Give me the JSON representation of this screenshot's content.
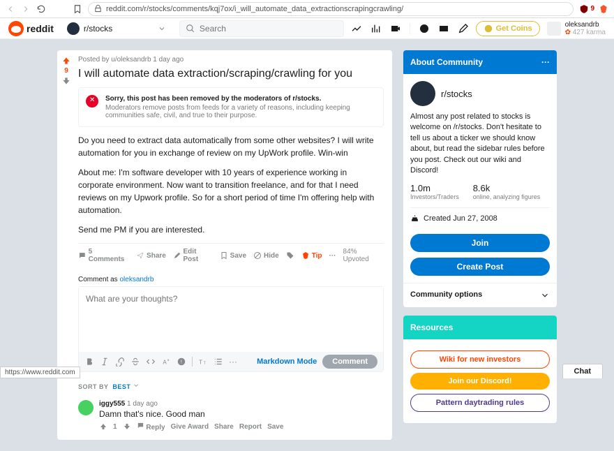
{
  "browser": {
    "url": "reddit.com/r/stocks/comments/kqj7ox/i_will_automate_data_extractionscrapingcrawling/",
    "status_url": "https://www.reddit.com",
    "ublock": "9"
  },
  "topbar": {
    "brand": "reddit",
    "sub": "r/stocks",
    "search_placeholder": "Search",
    "coins": "Get Coins",
    "username": "oleksandrb",
    "karma": "427 karma"
  },
  "post": {
    "score": "9",
    "meta": "Posted by u/oleksandrb 1 day ago",
    "title": "I will automate data extraction/scraping/crawling for you",
    "removed_bold": "Sorry, this post has been removed by the moderators of r/stocks.",
    "removed_text": "Moderators remove posts from feeds for a variety of reasons, including keeping communities safe, civil, and true to their purpose.",
    "p1": "Do you need to extract data automatically from some other websites? I will write automation for you in exchange of review on my UpWork profile. Win-win",
    "p2": "About me: I'm software developer with 10 years of experience working in corporate environment. Now want to transition freelance, and for that I need reviews on my Upwork profile. So for a short period of time I'm offering help with automation.",
    "p3": "Send me PM if you are interested.",
    "comments": "5 Comments",
    "share": "Share",
    "edit": "Edit Post",
    "save": "Save",
    "hide": "Hide",
    "tip": "Tip",
    "upvoted": "84% Upvoted"
  },
  "comment_box": {
    "label_pre": "Comment as ",
    "username": "oleksandrb",
    "placeholder": "What are your thoughts?",
    "markdown": "Markdown Mode",
    "button": "Comment"
  },
  "sort": {
    "label": "SORT BY",
    "value": "BEST"
  },
  "comments": [
    {
      "author": "iggy555",
      "age": "1 day ago",
      "text": "Damn that's nice. Good man",
      "score": "1",
      "reply": "Reply",
      "award": "Give Award",
      "share": "Share",
      "report": "Report",
      "save": "Save"
    }
  ],
  "about": {
    "header": "About Community",
    "sub": "r/stocks",
    "desc": "Almost any post related to stocks is welcome on /r/stocks. Don't hesitate to tell us about a ticker we should know about, but read the sidebar rules before you post. Check out our wiki and Discord!",
    "members_n": "1.0m",
    "members_l": "Investors/Traders",
    "online_n": "8.6k",
    "online_l": "online, analyzing figures",
    "created": "Created Jun 27, 2008",
    "join": "Join",
    "create": "Create Post",
    "opts": "Community options"
  },
  "resources": {
    "header": "Resources",
    "wiki": "Wiki for new investors",
    "discord": "Join our Discord!",
    "daytrade": "Pattern daytrading rules"
  },
  "chat": "Chat"
}
